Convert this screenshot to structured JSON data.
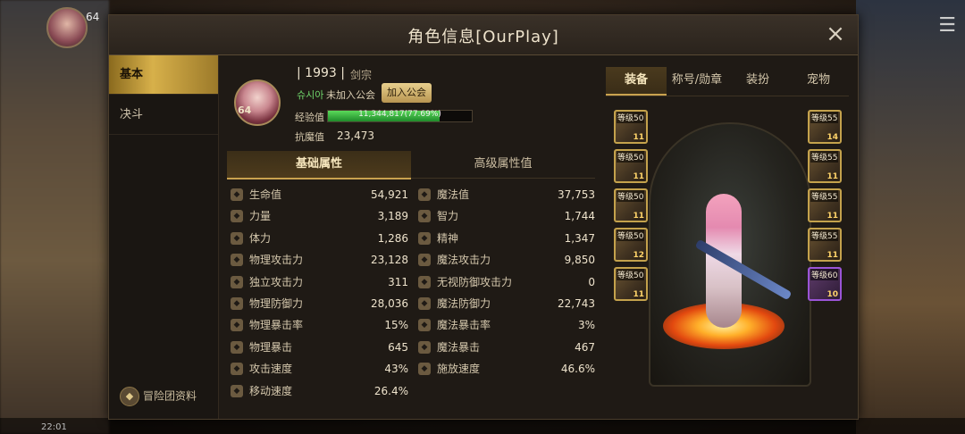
{
  "background": {
    "level": "64",
    "time": "22:01"
  },
  "window": {
    "title": "角色信息[OurPlay]",
    "close_label": "×"
  },
  "nav": {
    "items": [
      {
        "label": "基本",
        "active": true
      },
      {
        "label": "决斗",
        "active": false
      }
    ],
    "adventure_info": "冒险团资料"
  },
  "profile": {
    "avatar_level": "64",
    "number": "| 1993 |",
    "class_name": "剑宗",
    "character_name": "슈시아",
    "guild_status": "未加入公会",
    "join_guild_button": "加入公会",
    "exp_label": "经验值",
    "exp_text": "11,344,817(77.69%)",
    "exp_percent": 77.69,
    "resist_label": "抗魔值",
    "resist_value": "23,473"
  },
  "attr_tabs": {
    "basic": "基础属性",
    "advanced": "高级属性值"
  },
  "stats_left": [
    {
      "label": "生命值",
      "value": "54,921",
      "icon": "heart-icon"
    },
    {
      "label": "力量",
      "value": "3,189",
      "icon": "strength-icon"
    },
    {
      "label": "体力",
      "value": "1,286",
      "icon": "vitality-icon"
    },
    {
      "label": "物理攻击力",
      "value": "23,128",
      "icon": "sword-icon"
    },
    {
      "label": "独立攻击力",
      "value": "311",
      "icon": "independent-attack-icon"
    },
    {
      "label": "物理防御力",
      "value": "28,036",
      "icon": "shield-icon"
    },
    {
      "label": "物理暴击率",
      "value": "15%",
      "icon": "crit-rate-icon"
    },
    {
      "label": "物理暴击",
      "value": "645",
      "icon": "crit-icon"
    },
    {
      "label": "攻击速度",
      "value": "43%",
      "icon": "attack-speed-icon"
    },
    {
      "label": "移动速度",
      "value": "26.4%",
      "icon": "boot-icon"
    }
  ],
  "stats_right": [
    {
      "label": "魔法值",
      "value": "37,753",
      "icon": "mana-icon"
    },
    {
      "label": "智力",
      "value": "1,744",
      "icon": "intelligence-icon"
    },
    {
      "label": "精神",
      "value": "1,347",
      "icon": "spirit-icon"
    },
    {
      "label": "魔法攻击力",
      "value": "9,850",
      "icon": "magic-attack-icon"
    },
    {
      "label": "无视防御攻击力",
      "value": "0",
      "icon": "ignore-defense-icon"
    },
    {
      "label": "魔法防御力",
      "value": "22,743",
      "icon": "magic-defense-icon"
    },
    {
      "label": "魔法暴击率",
      "value": "3%",
      "icon": "magic-crit-rate-icon"
    },
    {
      "label": "魔法暴击",
      "value": "467",
      "icon": "magic-crit-icon"
    },
    {
      "label": "施放速度",
      "value": "46.6%",
      "icon": "cast-speed-icon"
    }
  ],
  "equip_tabs": [
    "装备",
    "称号/勋章",
    "装扮",
    "宠物"
  ],
  "equip_left": [
    {
      "level": "等级50",
      "count": "11"
    },
    {
      "level": "等级50",
      "count": "11"
    },
    {
      "level": "等级50",
      "count": "11"
    },
    {
      "level": "等级50",
      "count": "12"
    },
    {
      "level": "等级50",
      "count": "11"
    }
  ],
  "equip_right": [
    {
      "level": "等级55",
      "count": "14"
    },
    {
      "level": "等级55",
      "count": "11"
    },
    {
      "level": "等级55",
      "count": "11"
    },
    {
      "level": "等级55",
      "count": "11"
    },
    {
      "level": "等级60",
      "count": "10"
    }
  ]
}
